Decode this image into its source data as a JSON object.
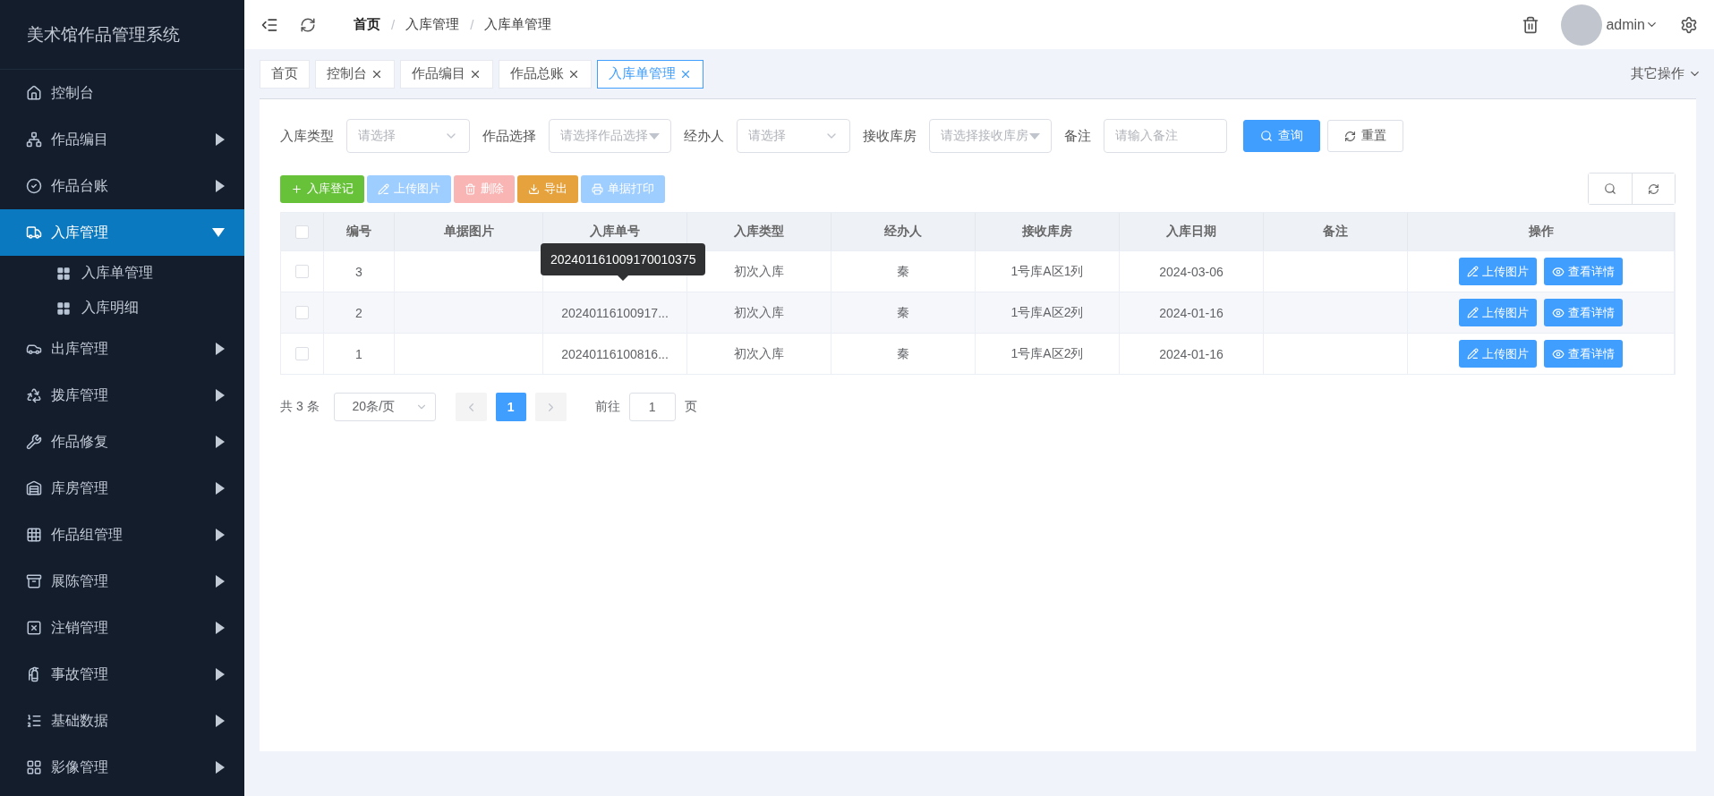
{
  "sidebar": {
    "title": "美术馆作品管理系统",
    "items": [
      {
        "label": "控制台",
        "kind": "link",
        "selected": false
      },
      {
        "label": "作品编目",
        "kind": "group",
        "selected": false,
        "expanded": false
      },
      {
        "label": "作品台账",
        "kind": "group",
        "selected": false,
        "expanded": false
      },
      {
        "label": "入库管理",
        "kind": "group",
        "selected": true,
        "expanded": true,
        "children": [
          {
            "label": "入库单管理",
            "selected": false
          },
          {
            "label": "入库明细",
            "selected": false
          }
        ]
      },
      {
        "label": "出库管理",
        "kind": "group",
        "selected": false,
        "expanded": false
      },
      {
        "label": "拨库管理",
        "kind": "group",
        "selected": false,
        "expanded": false
      },
      {
        "label": "作品修复",
        "kind": "group",
        "selected": false,
        "expanded": false
      },
      {
        "label": "库房管理",
        "kind": "group",
        "selected": false,
        "expanded": false
      },
      {
        "label": "作品组管理",
        "kind": "group",
        "selected": false,
        "expanded": false
      },
      {
        "label": "展陈管理",
        "kind": "group",
        "selected": false,
        "expanded": false
      },
      {
        "label": "注销管理",
        "kind": "group",
        "selected": false,
        "expanded": false
      },
      {
        "label": "事故管理",
        "kind": "group",
        "selected": false,
        "expanded": false
      },
      {
        "label": "基础数据",
        "kind": "group",
        "selected": false,
        "expanded": false
      },
      {
        "label": "影像管理",
        "kind": "group",
        "selected": false,
        "expanded": false
      }
    ]
  },
  "header": {
    "breadcrumb": [
      "首页",
      "入库管理",
      "入库单管理"
    ],
    "breadcrumb_separator": "/",
    "user": "admin"
  },
  "tabs": [
    {
      "label": "首页",
      "selected": false,
      "closable": false
    },
    {
      "label": "控制台",
      "selected": false,
      "closable": true
    },
    {
      "label": "作品编目",
      "selected": false,
      "closable": true
    },
    {
      "label": "作品总账",
      "selected": false,
      "closable": true
    },
    {
      "label": "入库单管理",
      "selected": true,
      "closable": true
    }
  ],
  "other_actions": "其它操作",
  "filters": [
    {
      "label": "入库类型",
      "placeholder": "请选择",
      "kind": "select"
    },
    {
      "label": "作品选择",
      "placeholder": "请选择作品选择",
      "kind": "dropdown"
    },
    {
      "label": "经办人",
      "placeholder": "请选择",
      "kind": "select"
    },
    {
      "label": "接收库房",
      "placeholder": "请选择接收库房",
      "kind": "dropdown"
    },
    {
      "label": "备注",
      "placeholder": "请输入备注",
      "kind": "input"
    }
  ],
  "search_button": "查询",
  "reset_button": "重置",
  "toolbar": [
    {
      "label": "入库登记",
      "kind": "add",
      "disabled": false
    },
    {
      "label": "上传图片",
      "kind": "upload",
      "disabled": true
    },
    {
      "label": "删除",
      "kind": "delete",
      "disabled": true
    },
    {
      "label": "导出",
      "kind": "export",
      "disabled": false
    },
    {
      "label": "单据打印",
      "kind": "print",
      "disabled": true
    }
  ],
  "table": {
    "header_checked": false,
    "columns": [
      "编号",
      "单据图片",
      "入库单号",
      "入库类型",
      "经办人",
      "接收库房",
      "入库日期",
      "备注",
      "操作"
    ],
    "rows": [
      {
        "checked": false,
        "id": "3",
        "type": "初次入库",
        "handler": "秦",
        "warehouse": "1号库A区1列",
        "date": "2024-03-06",
        "actions": [
          "上传图片",
          "查看详情"
        ]
      },
      {
        "checked": false,
        "id": "2",
        "order_no": "20240116100917...",
        "type": "初次入库",
        "handler": "秦",
        "warehouse": "1号库A区2列",
        "date": "2024-01-16",
        "actions": [
          "上传图片",
          "查看详情"
        ]
      },
      {
        "checked": false,
        "id": "1",
        "order_no": "20240116100816...",
        "type": "初次入库",
        "handler": "秦",
        "warehouse": "1号库A区2列",
        "date": "2024-01-16",
        "actions": [
          "上传图片",
          "查看详情"
        ]
      }
    ],
    "tooltip": "202401161009170010375"
  },
  "pagination": {
    "total": "共 3 条",
    "page_size": "20条/页",
    "prev_disabled": true,
    "next_disabled": true,
    "pages": [
      {
        "label": "1",
        "selected": true
      }
    ],
    "goto_label": "前往",
    "goto_value": "1",
    "page_unit": "页"
  }
}
